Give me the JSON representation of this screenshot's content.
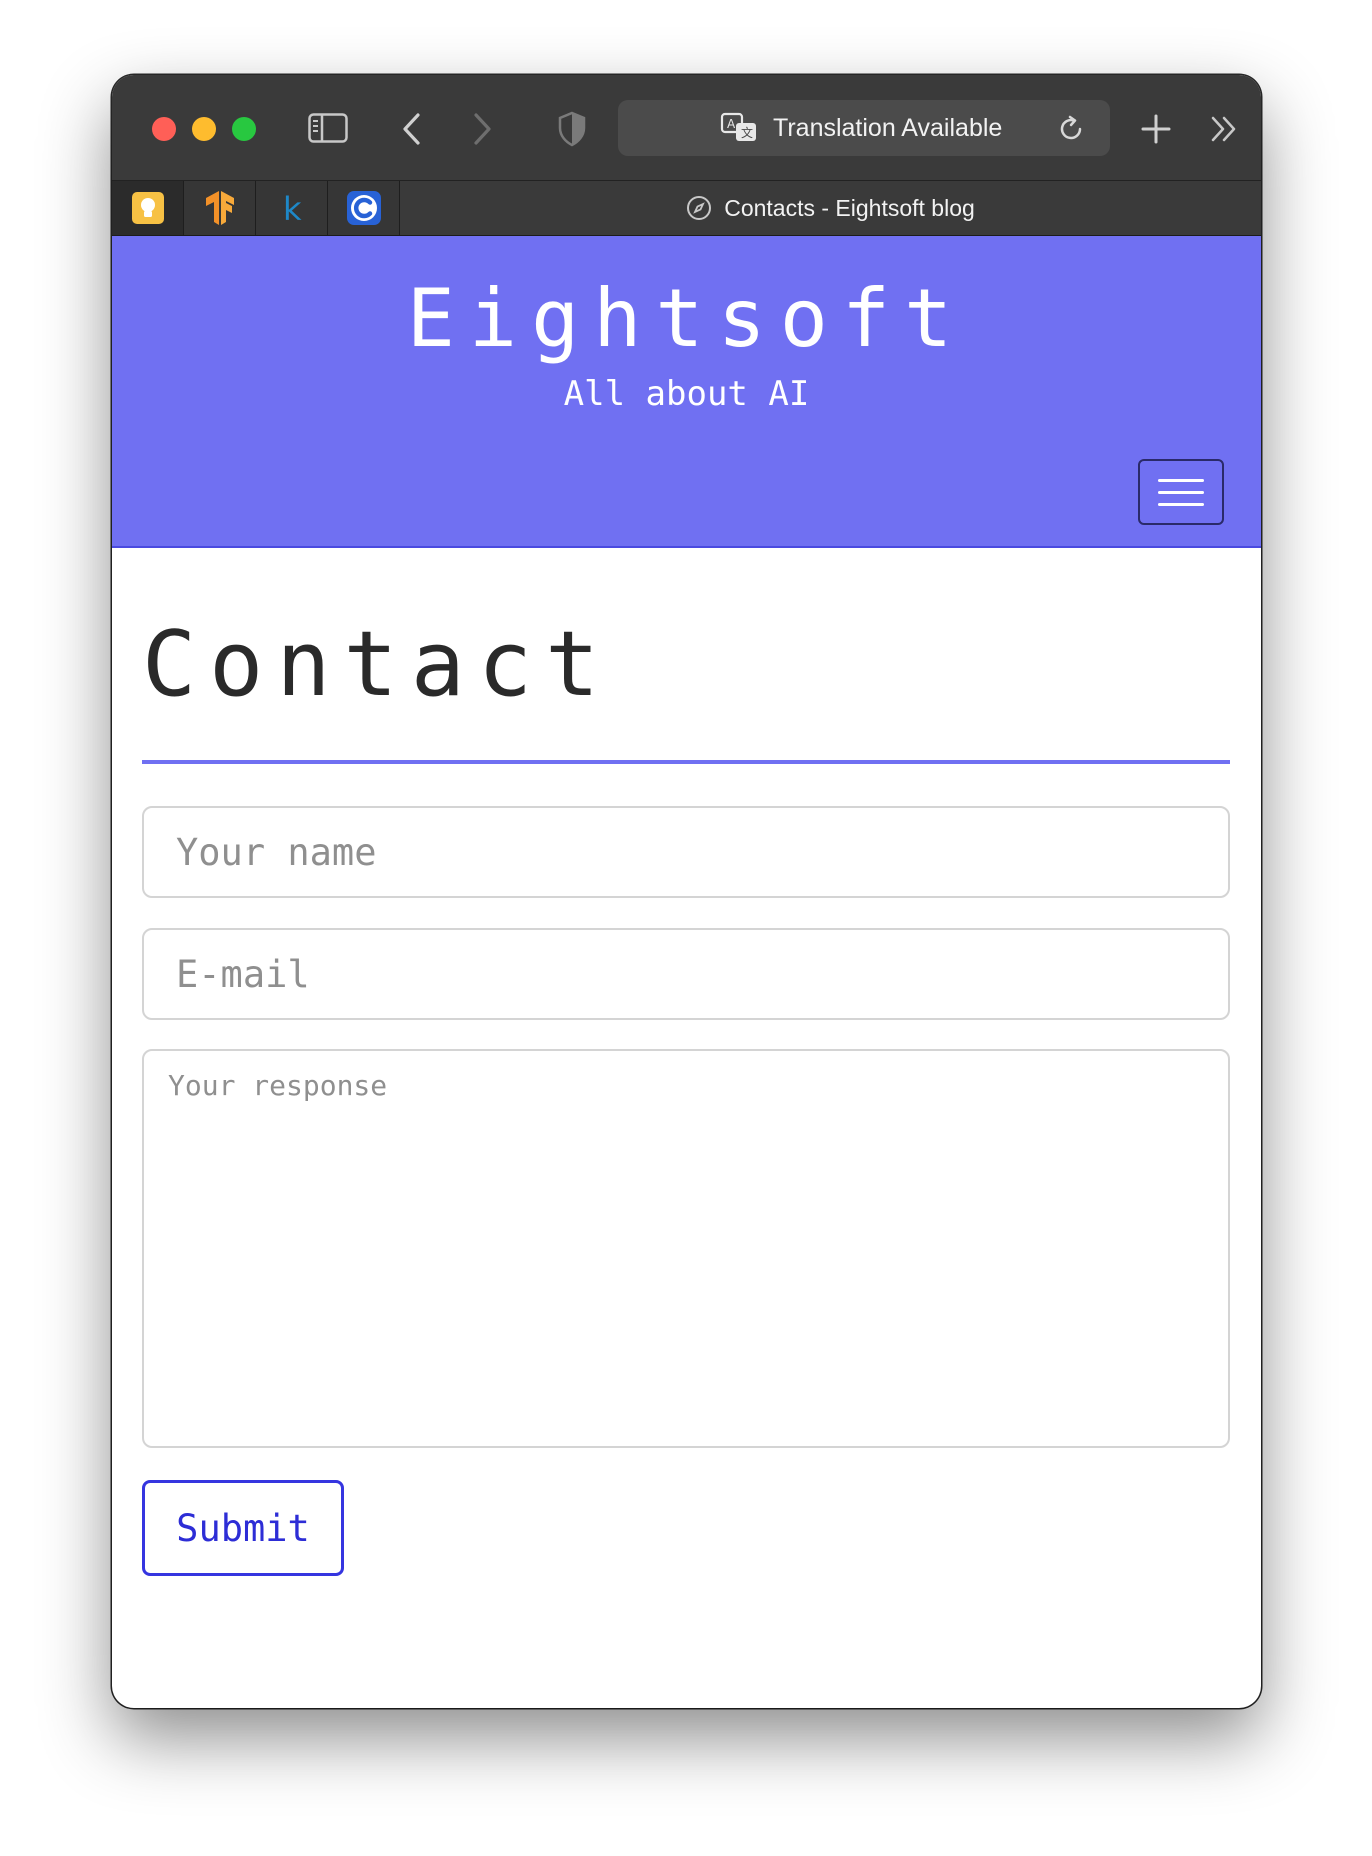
{
  "browser": {
    "address_bar": {
      "text": "Translation Available",
      "translate_icon": "translate-icon",
      "reload_icon": "reload-icon"
    },
    "toolbar_icons": [
      "sidebar-toggle-icon",
      "back-icon",
      "forward-icon",
      "shield-icon",
      "plus-icon",
      "double-chevron-icon"
    ],
    "pinned_tabs": [
      {
        "icon": "bulb-icon",
        "color": "#f7c144"
      },
      {
        "icon": "tensorflow-icon",
        "color": "#f39128"
      },
      {
        "icon": "k-icon",
        "color": "#1e88c8",
        "glyph": "k"
      },
      {
        "icon": "c-icon",
        "color": "#2862d6",
        "glyph": "C"
      }
    ],
    "active_tab": {
      "title": "Contacts - Eightsoft blog",
      "icon": "compass-icon"
    }
  },
  "site": {
    "title": "Eightsoft",
    "subtitle": "All about AI",
    "header_color": "#7070f2",
    "menu_icon": "hamburger-icon"
  },
  "page": {
    "heading": "Contact",
    "form": {
      "name_placeholder": "Your name",
      "email_placeholder": "E-mail",
      "response_placeholder": "Your response",
      "submit_label": "Submit"
    },
    "accent_color": "#3535e0"
  }
}
